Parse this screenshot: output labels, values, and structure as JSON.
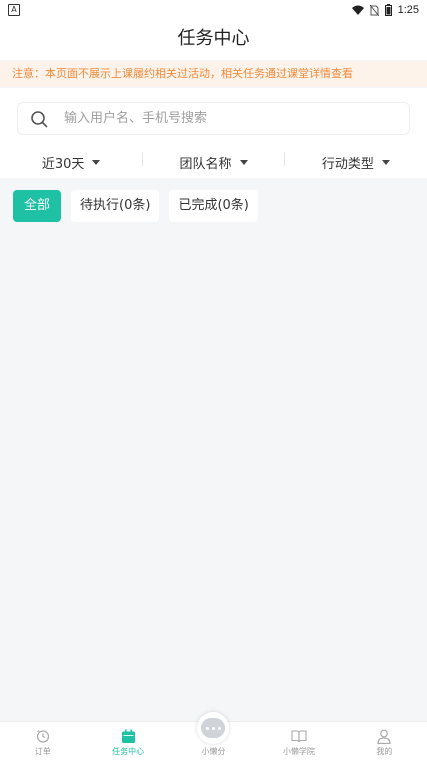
{
  "status_bar": {
    "time": "1:25"
  },
  "header": {
    "title": "任务中心"
  },
  "notice": {
    "text": "注意：本页面不展示上课履约相关过活动，相关任务通过课堂详情查看"
  },
  "search": {
    "placeholder": "输入用户名、手机号搜索"
  },
  "filters": [
    {
      "label": "近30天"
    },
    {
      "label": "团队名称"
    },
    {
      "label": "行动类型"
    }
  ],
  "tabs": [
    {
      "label": "全部"
    },
    {
      "label": "待执行(0条)"
    },
    {
      "label": "已完成(0条)"
    }
  ],
  "bottom_nav": [
    {
      "label": "订单",
      "icon": "clock-icon"
    },
    {
      "label": "任务中心",
      "icon": "calendar-icon"
    },
    {
      "label": "小懒分",
      "icon": "robot-icon"
    },
    {
      "label": "小懒学院",
      "icon": "book-icon"
    },
    {
      "label": "我的",
      "icon": "person-icon"
    }
  ],
  "colors": {
    "accent": "#1ec1a4",
    "notice_bg": "#fdf3ea",
    "notice_text": "#f08a3a"
  }
}
